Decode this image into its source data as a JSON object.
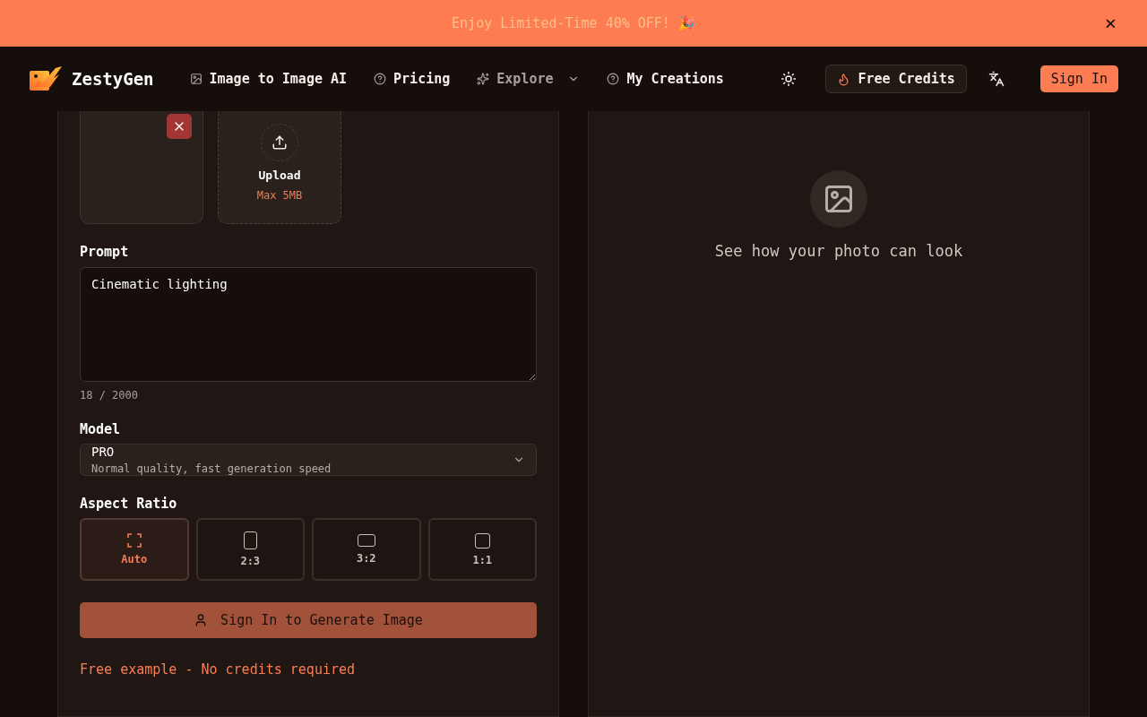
{
  "banner": {
    "text": "Enjoy Limited-Time 40% OFF! 🎉",
    "close": "×"
  },
  "header": {
    "brand": "ZestyGen",
    "nav": [
      {
        "label": "Image to Image AI",
        "kind": "link"
      },
      {
        "label": "Pricing",
        "kind": "link"
      },
      {
        "label": "Explore",
        "kind": "dropdown"
      },
      {
        "label": "My Creations",
        "kind": "link"
      }
    ],
    "credits_button": "Free Credits",
    "sign_in": "Sign In"
  },
  "form": {
    "upload": {
      "label": "Upload",
      "limit": "Max 5MB"
    },
    "prompt": {
      "label": "Prompt",
      "value": "Cinematic lighting",
      "counter": "18 / 2000"
    },
    "model": {
      "label": "Model",
      "name": "PRO",
      "description": "Normal quality, fast generation speed"
    },
    "aspect_ratio": {
      "label": "Aspect Ratio",
      "options": [
        {
          "label": "Auto",
          "kind": "auto",
          "selected": true
        },
        {
          "label": "2:3",
          "kind": "portrait",
          "selected": false
        },
        {
          "label": "3:2",
          "kind": "landscape",
          "selected": false
        },
        {
          "label": "1:1",
          "kind": "square",
          "selected": false
        }
      ]
    },
    "submit": "Sign In to Generate Image",
    "note": "Free example - No credits required"
  },
  "preview": {
    "message": "See how your photo can look"
  }
}
